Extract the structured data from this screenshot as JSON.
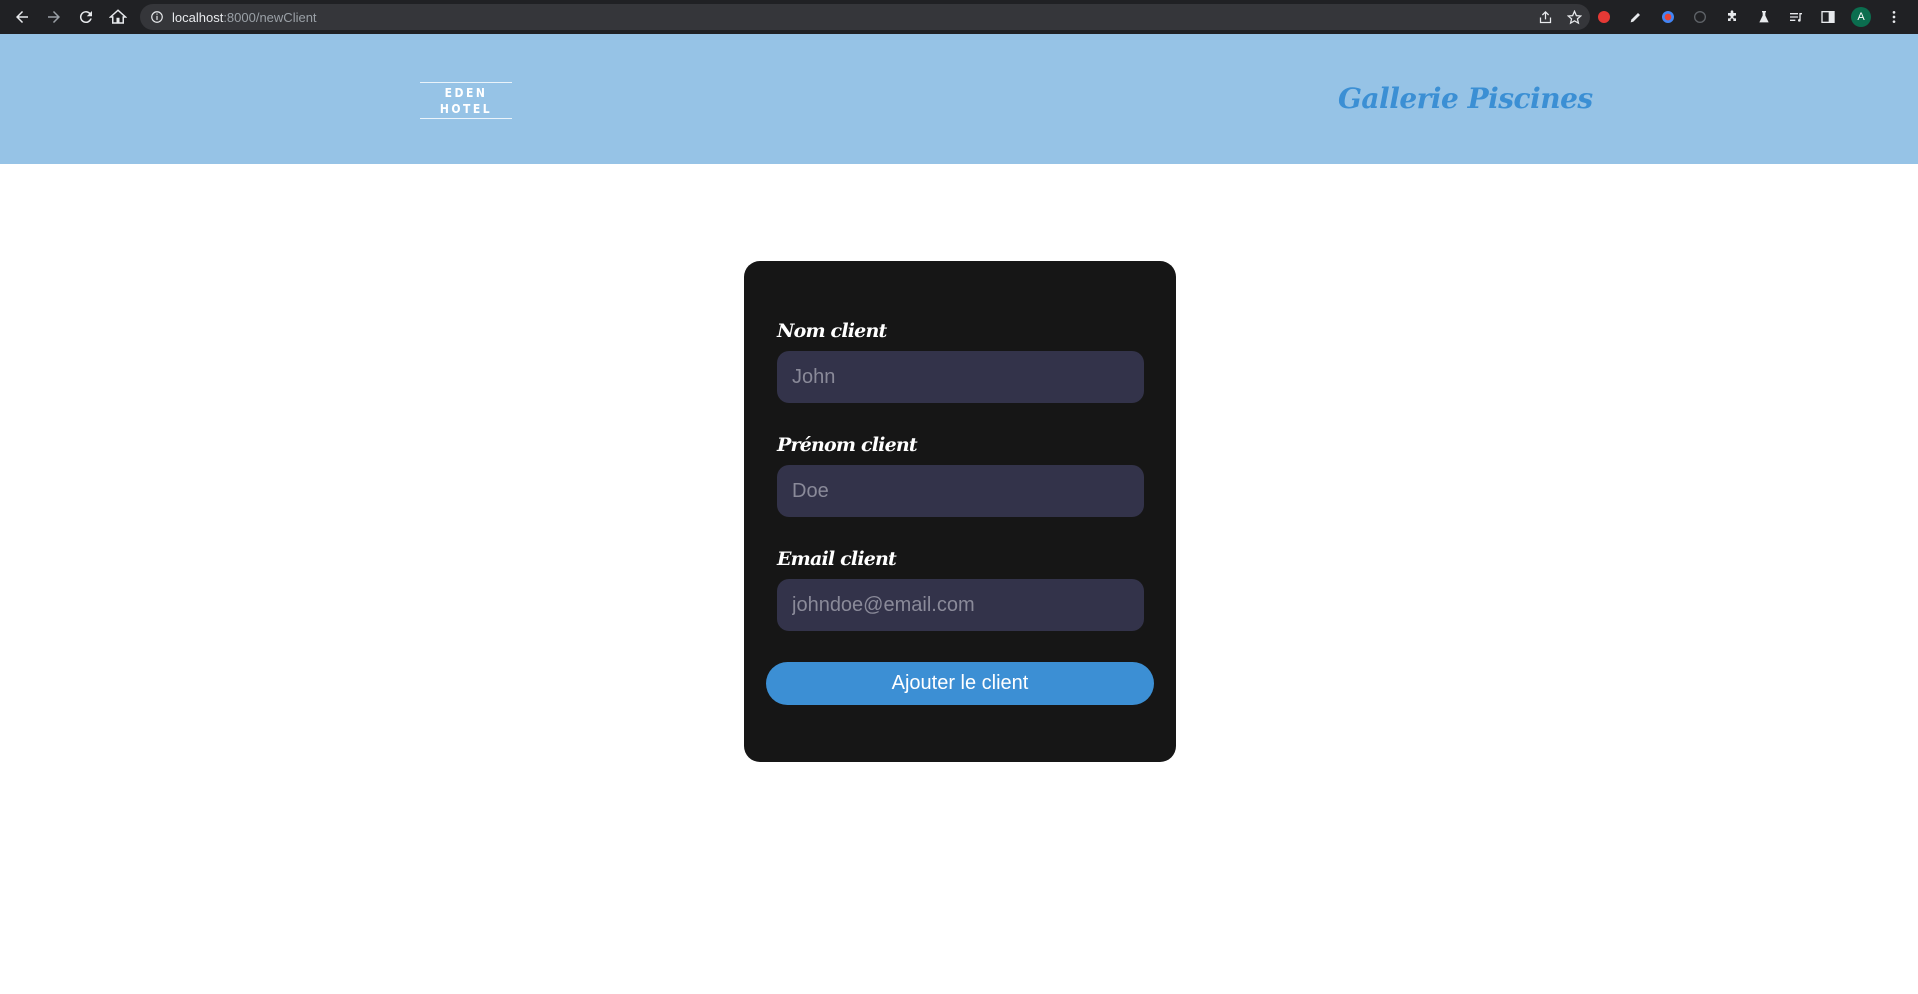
{
  "browser": {
    "url_host": "localhost",
    "url_path": ":8000/newClient",
    "avatar_letter": "A"
  },
  "header": {
    "logo_text": "EDEN HOTEL",
    "gallery_link": "Gallerie Piscines",
    "background_color": "#96c3e6",
    "link_color": "#3b8fd4"
  },
  "form": {
    "fields": [
      {
        "label": "Nom client",
        "placeholder": "John"
      },
      {
        "label": "Prénom client",
        "placeholder": "Doe"
      },
      {
        "label": "Email client",
        "placeholder": "johndoe@email.com"
      }
    ],
    "submit_label": "Ajouter le client",
    "card_color": "#161616",
    "input_color": "#33334a",
    "button_color": "#3c8fd4"
  }
}
